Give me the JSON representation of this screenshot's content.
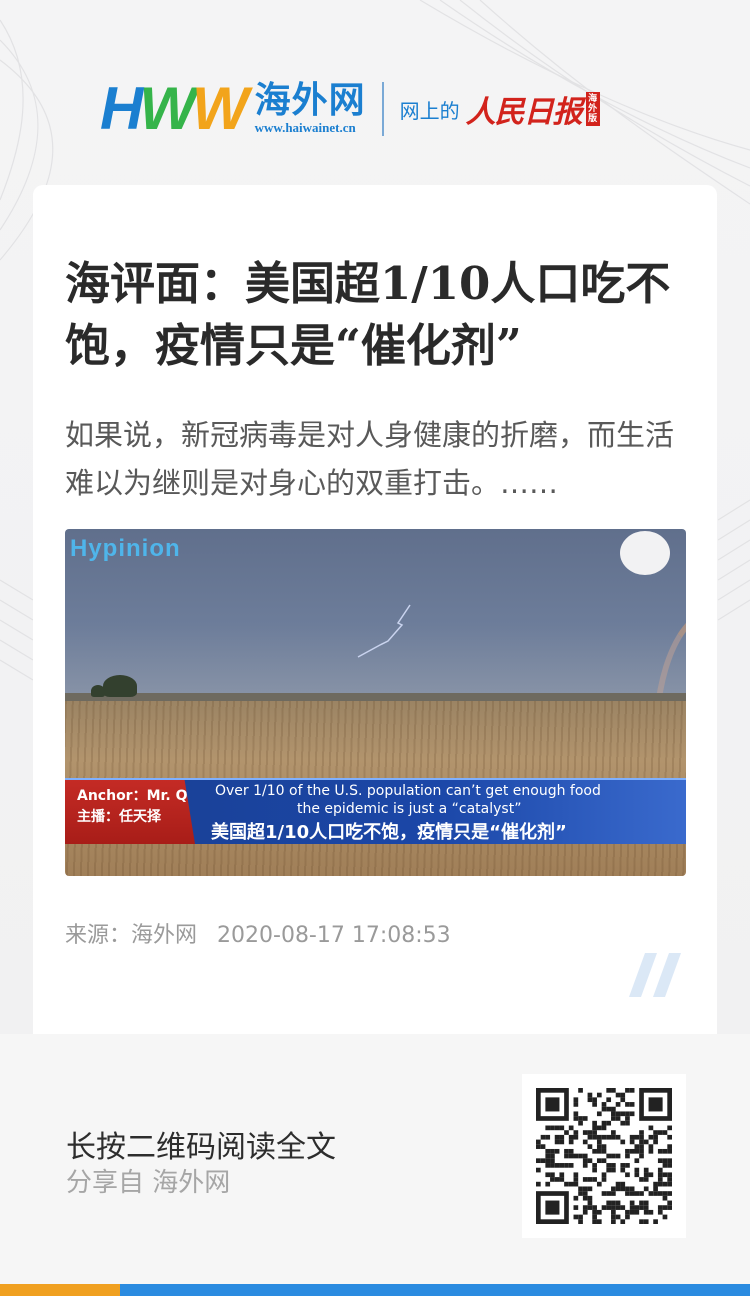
{
  "header": {
    "logo_letters": [
      "H",
      "W",
      "W"
    ],
    "logo_cn": "海外网",
    "logo_url": "www.haiwainet.cn",
    "net_text": "网上的",
    "rmrb": "人民日报",
    "overseas_badge": "海外版"
  },
  "article": {
    "title": "海评面：美国超1/10人口吃不饱，疫情只是“催化剂”",
    "summary": "如果说，新冠病毒是对人身健康的折磨，而生活难以为继则是对身心的双重打击。……",
    "image": {
      "brand": "Hypinion",
      "anchor_en": "Anchor：Mr. Q",
      "anchor_cn": "主播：任天择",
      "caption_en_1": "Over 1/10 of the U.S. population can’t get enough food",
      "caption_en_2": "the epidemic is just a “catalyst”",
      "caption_cn": "美国超1/10人口吃不饱，疫情只是“催化剂”"
    },
    "source_label": "来源：海外网",
    "timestamp": "2020-08-17 17:08:53"
  },
  "footer": {
    "read_full": "长按二维码阅读全文",
    "share_from": "分享自 海外网"
  },
  "colors": {
    "brand_blue": "#1b7fd0",
    "brand_green": "#35b44a",
    "brand_orange": "#f2a41b",
    "rmrb_red": "#d2231c"
  }
}
